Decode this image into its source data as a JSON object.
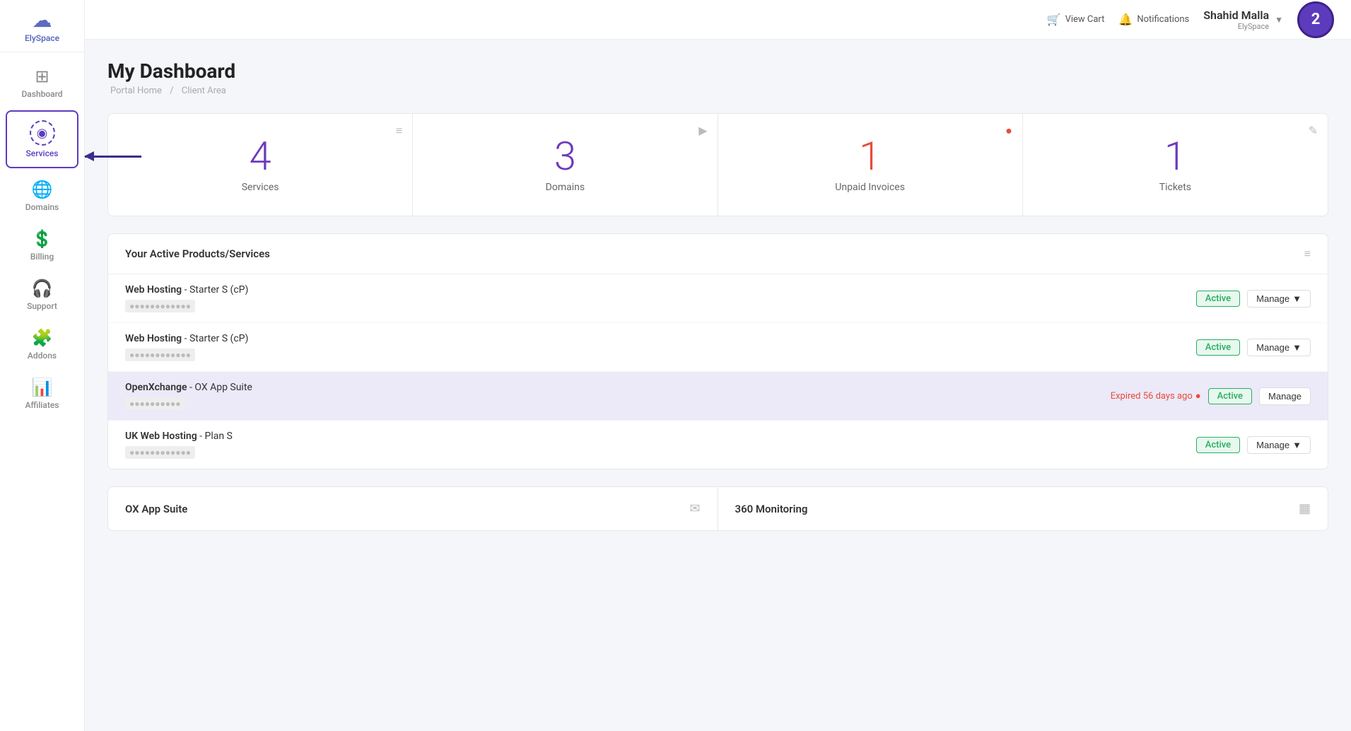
{
  "logo": {
    "icon": "☁",
    "text": "ElySpace"
  },
  "sidebar": {
    "items": [
      {
        "id": "dashboard",
        "label": "Dashboard",
        "icon": "⊞",
        "active": false
      },
      {
        "id": "services",
        "label": "Services",
        "icon": "◉",
        "active": true
      },
      {
        "id": "domains",
        "label": "Domains",
        "icon": "🌐",
        "active": false
      },
      {
        "id": "billing",
        "label": "Billing",
        "icon": "💲",
        "active": false
      },
      {
        "id": "support",
        "label": "Support",
        "icon": "🎧",
        "active": false
      },
      {
        "id": "addons",
        "label": "Addons",
        "icon": "🧩",
        "active": false
      },
      {
        "id": "affiliates",
        "label": "Affiliates",
        "icon": "📊",
        "active": false
      }
    ]
  },
  "topbar": {
    "view_cart": "View Cart",
    "notifications": "Notifications",
    "user_name": "Shahid Malla",
    "user_sub": "ElySpace",
    "user_avatar": "2"
  },
  "page": {
    "title": "My Dashboard",
    "breadcrumb_home": "Portal Home",
    "breadcrumb_sep": "/",
    "breadcrumb_current": "Client Area"
  },
  "stats": [
    {
      "number": "4",
      "label": "Services",
      "icon": "≡",
      "alert": false
    },
    {
      "number": "3",
      "label": "Domains",
      "icon": "▶",
      "alert": false
    },
    {
      "number": "1",
      "label": "Unpaid Invoices",
      "icon": "!",
      "alert": true
    },
    {
      "number": "1",
      "label": "Tickets",
      "icon": "✎",
      "alert": false
    }
  ],
  "products_section": {
    "title": "Your Active Products/Services",
    "icon": "≡",
    "services": [
      {
        "name": "Web Hosting",
        "plan": "Starter S (cP)",
        "domain": "••••••••••••",
        "status": "Active",
        "highlighted": false,
        "expired_text": ""
      },
      {
        "name": "Web Hosting",
        "plan": "Starter S (cP)",
        "domain": "••••••••••••",
        "status": "Active",
        "highlighted": false,
        "expired_text": ""
      },
      {
        "name": "OpenXchange",
        "plan": "OX App Suite",
        "domain": "••••••••••",
        "status": "Active",
        "highlighted": true,
        "expired_text": "Expired 56 days ago"
      },
      {
        "name": "UK Web Hosting",
        "plan": "Plan S",
        "domain": "••••••••••••",
        "status": "Active",
        "highlighted": false,
        "expired_text": ""
      }
    ]
  },
  "bottom_section": {
    "left_title": "OX App Suite",
    "left_icon": "✉",
    "right_title": "360 Monitoring",
    "right_icon": "▦"
  },
  "buttons": {
    "manage": "Manage"
  }
}
